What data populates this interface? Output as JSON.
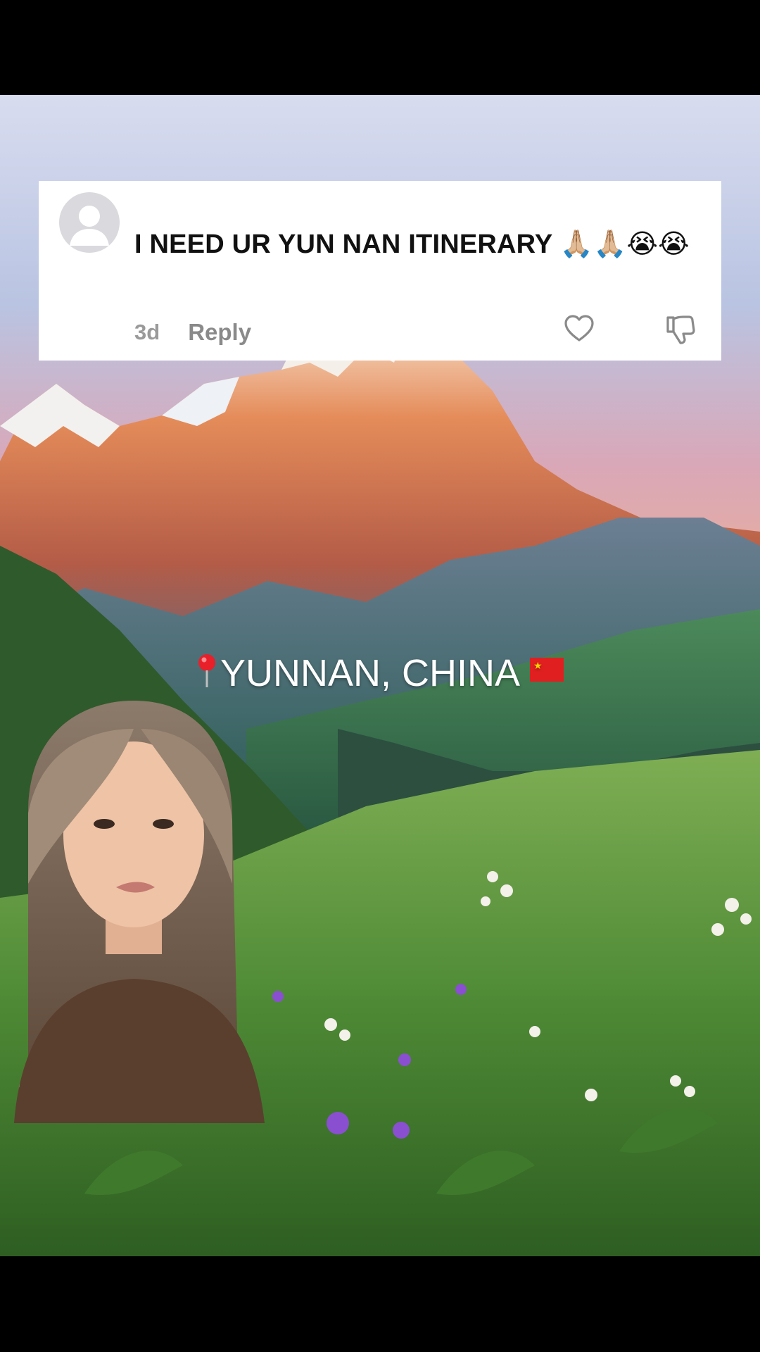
{
  "comment": {
    "text": "I NEED UR YUN NAN ITINERARY 🙏🏼🙏🏼😭😭",
    "time": "3d",
    "reply_label": "Reply"
  },
  "overlay": {
    "location_text": "YUNNAN, CHINA",
    "pin_icon": "round-pushpin-icon",
    "flag_icon": "china-flag-icon"
  },
  "colors": {
    "sky_top": "#cfd3e6",
    "sky_glow": "#f2b38f",
    "peak_orange": "#e07a4a",
    "meadow_green": "#4f8f3a"
  }
}
